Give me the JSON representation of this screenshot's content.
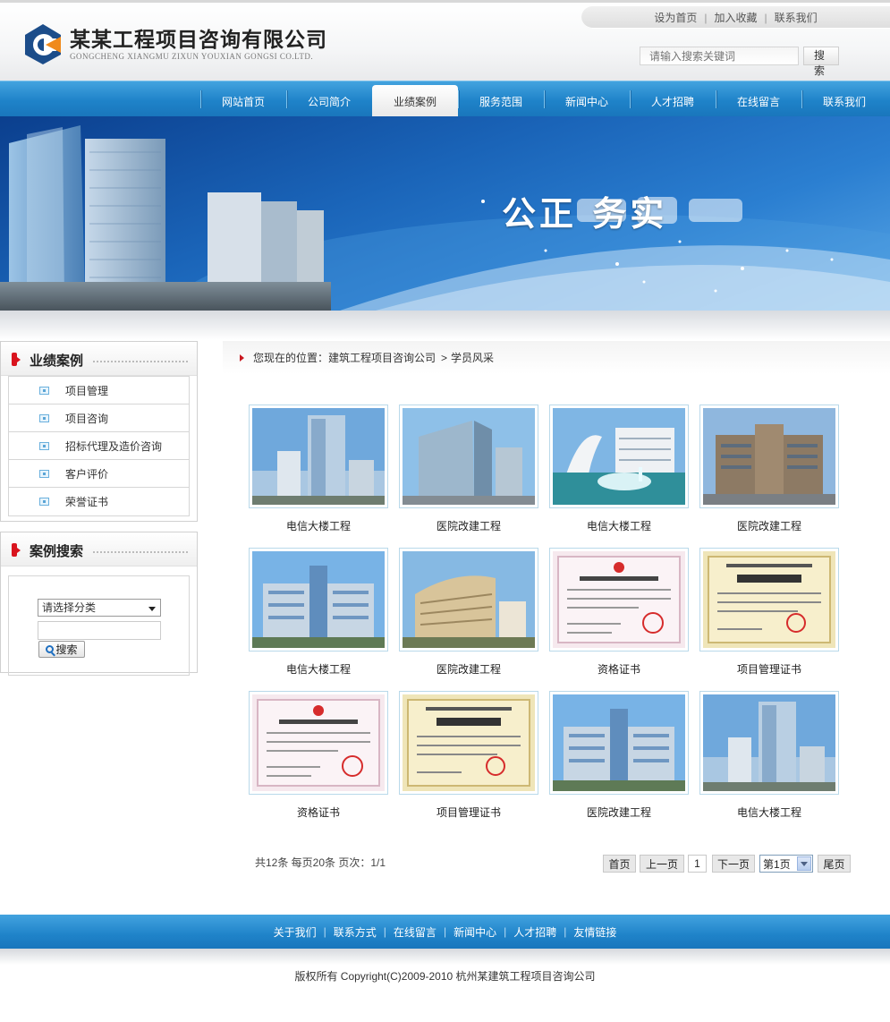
{
  "header": {
    "company_name": "某某工程项目咨询有限公司",
    "company_name_en": "GONGCHENG XIANGMU ZIXUN YOUXIAN GONGSI CO.LTD.",
    "top_links": [
      "设为首页",
      "加入收藏",
      "联系我们"
    ],
    "search_placeholder": "请输入搜索关键词",
    "search_button": "搜 索"
  },
  "nav": {
    "items": [
      "网站首页",
      "公司简介",
      "业绩案例",
      "服务范围",
      "新闻中心",
      "人才招聘",
      "在线留言",
      "联系我们"
    ],
    "active_index": 2
  },
  "banner": {
    "slogan": "公正  务实"
  },
  "sidebar": {
    "cases": {
      "title": "业绩案例",
      "items": [
        "项目管理",
        "项目咨询",
        "招标代理及造价咨询",
        "客户评价",
        "荣誉证书"
      ]
    },
    "search": {
      "title": "案例搜索",
      "select_value": "请选择分类",
      "button": "搜索"
    }
  },
  "breadcrumb": {
    "prefix": "您现在的位置：",
    "site": "建筑工程项目咨询公司",
    "separator": ">",
    "current": "学员风采"
  },
  "gallery": [
    {
      "caption": "电信大楼工程",
      "image": "building-tower"
    },
    {
      "caption": "医院改建工程",
      "image": "building-glass"
    },
    {
      "caption": "电信大楼工程",
      "image": "building-fountain"
    },
    {
      "caption": "医院改建工程",
      "image": "building-brown"
    },
    {
      "caption": "电信大楼工程",
      "image": "building-wide"
    },
    {
      "caption": "医院改建工程",
      "image": "building-hospital"
    },
    {
      "caption": "资格证书",
      "image": "certificate-pink"
    },
    {
      "caption": "项目管理证书",
      "image": "certificate-yellow"
    },
    {
      "caption": "资格证书",
      "image": "certificate-pink"
    },
    {
      "caption": "项目管理证书",
      "image": "certificate-yellow"
    },
    {
      "caption": "医院改建工程",
      "image": "building-wide"
    },
    {
      "caption": "电信大楼工程",
      "image": "building-tower"
    }
  ],
  "pagination": {
    "info": "共12条  每页20条  页次：1/1",
    "first": "首页",
    "prev": "上一页",
    "current_page": "1",
    "next": "下一页",
    "select_value": "第1页",
    "last": "尾页"
  },
  "footer": {
    "links": [
      "关于我们",
      "联系方式",
      "在线留言",
      "新闻中心",
      "人才招聘",
      "友情链接"
    ],
    "copyright": "版权所有  Copyright(C)2009-2010 杭州某建筑工程项目咨询公司"
  },
  "colors": {
    "nav_blue": "#1f83c9",
    "accent_red": "#d9141e",
    "thumb_border": "#b9d9ea"
  }
}
